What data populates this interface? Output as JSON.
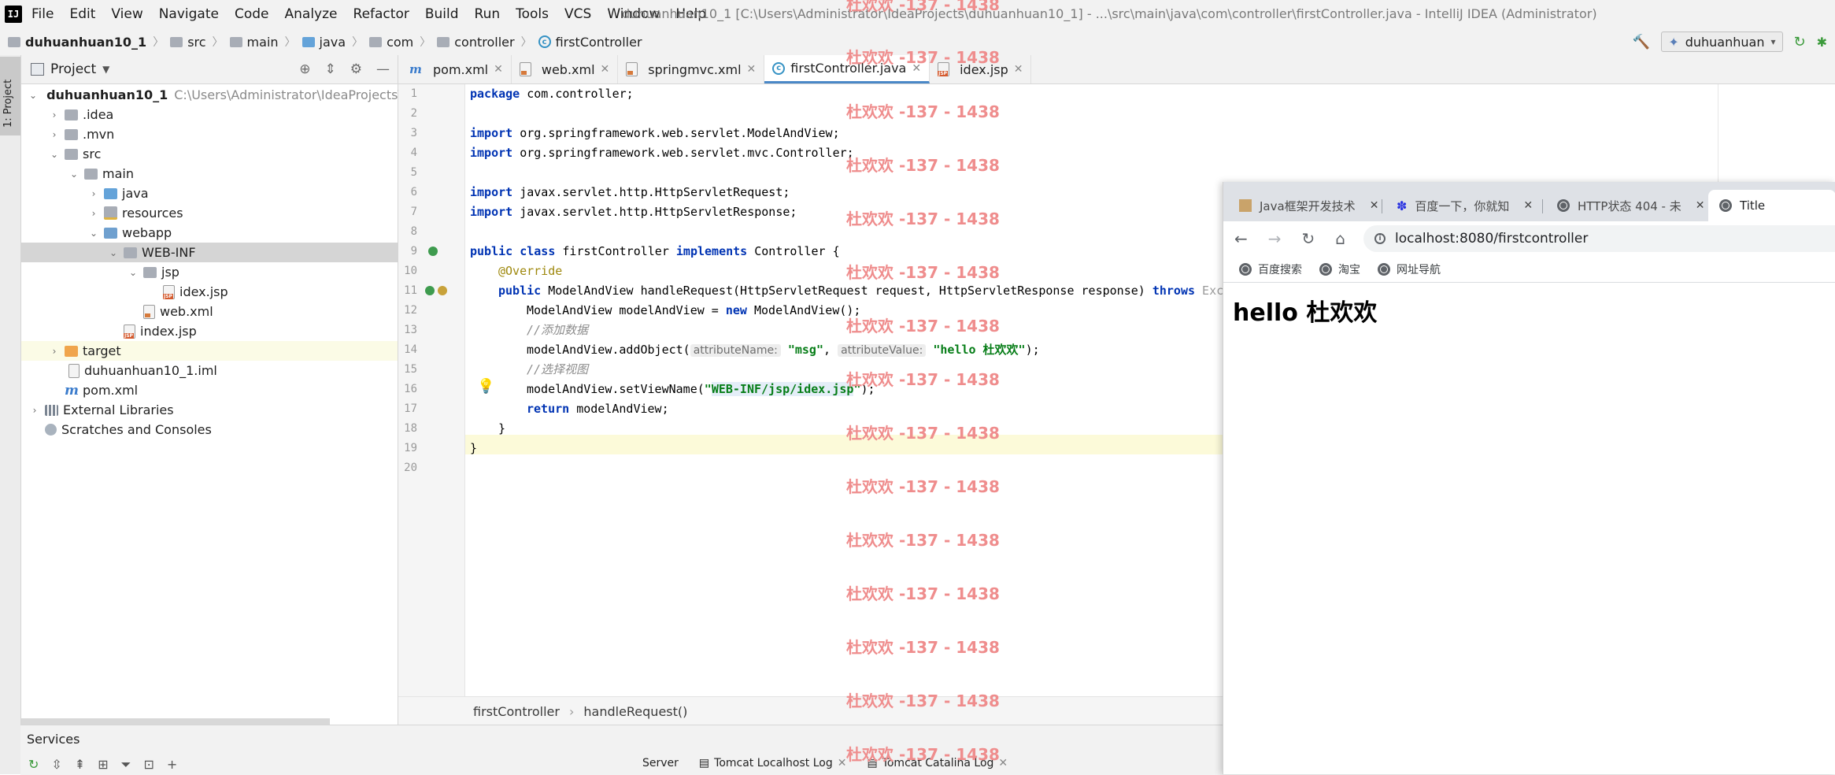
{
  "app": {
    "logo_text": "IJ",
    "window_title": "duhuanhuan10_1 [C:\\Users\\Administrator\\IdeaProjects\\duhuanhuan10_1] - ...\\src\\main\\java\\com\\controller\\firstController.java - IntelliJ IDEA (Administrator)"
  },
  "menu": [
    "File",
    "Edit",
    "View",
    "Navigate",
    "Code",
    "Analyze",
    "Refactor",
    "Build",
    "Run",
    "Tools",
    "VCS",
    "Window",
    "Help"
  ],
  "breadcrumb": [
    "duhuanhuan10_1",
    "src",
    "main",
    "java",
    "com",
    "controller",
    "firstController"
  ],
  "run_config": "duhuanhuan",
  "side_stripe": {
    "project_tab": "1: Project"
  },
  "project": {
    "title": "Project",
    "tree": [
      {
        "label": "duhuanhuan10_1",
        "hint": "C:\\Users\\Administrator\\IdeaProjects\\du"
      },
      {
        "label": ".idea"
      },
      {
        "label": ".mvn"
      },
      {
        "label": "src"
      },
      {
        "label": "main"
      },
      {
        "label": "java"
      },
      {
        "label": "resources"
      },
      {
        "label": "webapp"
      },
      {
        "label": "WEB-INF"
      },
      {
        "label": "jsp"
      },
      {
        "label": "idex.jsp"
      },
      {
        "label": "web.xml"
      },
      {
        "label": "index.jsp"
      },
      {
        "label": "target"
      },
      {
        "label": "duhuanhuan10_1.iml"
      },
      {
        "label": "pom.xml"
      },
      {
        "label": "External Libraries"
      },
      {
        "label": "Scratches and Consoles"
      }
    ]
  },
  "editor": {
    "tabs": [
      "pom.xml",
      "web.xml",
      "springmvc.xml",
      "firstController.java",
      "idex.jsp"
    ],
    "active_tab": "firstController.java",
    "line_numbers": [
      "1",
      "2",
      "3",
      "4",
      "5",
      "6",
      "7",
      "8",
      "9",
      "10",
      "11",
      "12",
      "13",
      "14",
      "15",
      "16",
      "17",
      "18",
      "19",
      "20"
    ],
    "code": {
      "l1_kw": "package",
      "l1_rest": " com.controller;",
      "l3_kw": "import",
      "l3_rest": " org.springframework.web.servlet.ModelAndView;",
      "l4_kw": "import",
      "l4_rest": " org.springframework.web.servlet.mvc.Controller;",
      "l6_kw": "import",
      "l6_rest": " javax.servlet.http.HttpServletRequest;",
      "l7_kw": "import",
      "l7_rest": " javax.servlet.http.HttpServletResponse;",
      "l9_kw1": "public class",
      "l9_mid": " firstController ",
      "l9_kw2": "implements",
      "l9_rest": " Controller {",
      "l10": "@Override",
      "l11_kw": "public",
      "l11_mid": " ModelAndView handleRequest(HttpServletRequest request, HttpServletResponse response) ",
      "l11_kw2": "throws",
      "l11_rest": " Exce",
      "l12_a": "ModelAndView modelAndView = ",
      "l12_kw": "new",
      "l12_b": " ModelAndView();",
      "l13": "//添加数据",
      "l14_a": "modelAndView.addObject(",
      "l14_h1": "attributeName:",
      "l14_s1": "\"msg\"",
      "l14_c": ",",
      "l14_h2": "attributeValue:",
      "l14_s2": "\"hello 杜欢欢\"",
      "l14_end": ");",
      "l15": "//选择视图",
      "l16_a": "modelAndView.setViewName(",
      "l16_q1": "\"",
      "l16_s": "WEB-INF/jsp/idex.jsp",
      "l16_q2": "\"",
      "l16_end": ");",
      "l17_kw": "return",
      "l17_rest": " modelAndView;",
      "l18": "}",
      "l19": "}"
    },
    "status_breadcrumb": [
      "firstController",
      "handleRequest()"
    ]
  },
  "services": {
    "title": "Services",
    "tabs": [
      "Server",
      "Tomcat Localhost Log",
      "Tomcat Catalina Log"
    ]
  },
  "watermark": "杜欢欢 -137 - 1438",
  "browser": {
    "tabs": [
      {
        "title": "Java框架开发技术"
      },
      {
        "title": "百度一下，你就知"
      },
      {
        "title": "HTTP状态 404 - 未"
      },
      {
        "title": "Title"
      }
    ],
    "url": "localhost:8080/firstcontroller",
    "bookmarks": [
      "百度搜索",
      "淘宝",
      "网址导航"
    ],
    "page_heading": "hello 杜欢欢"
  }
}
